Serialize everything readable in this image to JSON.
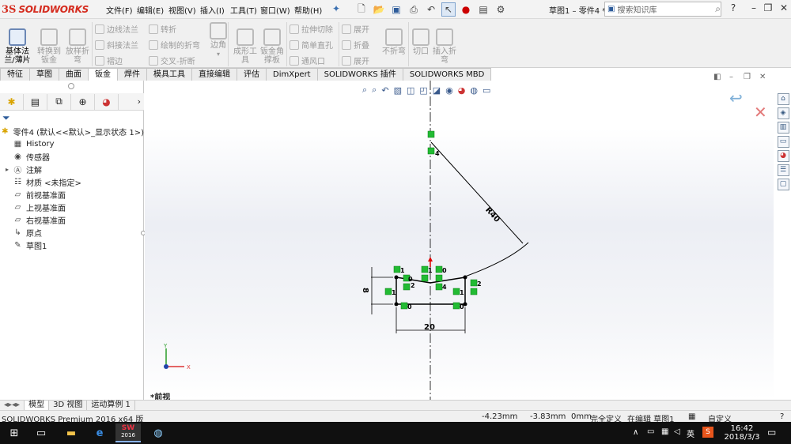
{
  "app": {
    "logo_ds": "3S",
    "logo_name": "SOLIDWORKS",
    "doc_title": "草图1 – 零件4 *",
    "search_placeholder": "搜索知识库"
  },
  "menu": [
    "文件(F)",
    "编辑(E)",
    "视图(V)",
    "插入(I)",
    "工具(T)",
    "窗口(W)",
    "帮助(H)"
  ],
  "ribbon": {
    "base_flange": "基体法\n兰/薄片",
    "convert_sheet": "转换到\n钣金",
    "lofted_bend": "放样折\n弯",
    "edge_flange": "边线法兰",
    "miter_flange": "斜接法兰",
    "hem": "褶边",
    "jog": "转折",
    "sketched_bend": "绘制的折弯",
    "cross_break": "交叉-折断",
    "corners": "边角",
    "forming_tool": "成形工\n具",
    "gusset": "钣金角\n撑板",
    "extruded_cut": "拉伸切除",
    "simple_hole": "简单直孔",
    "vent": "通风口",
    "unfold": "展开",
    "fold": "折叠",
    "flatten": "展开",
    "no_bends": "不折弯",
    "rip": "切口",
    "insert_bends": "插入折\n弯"
  },
  "tabs": [
    "特征",
    "草图",
    "曲面",
    "钣金",
    "焊件",
    "模具工具",
    "直接编辑",
    "评估",
    "DimXpert",
    "SOLIDWORKS 插件",
    "SOLIDWORKS MBD"
  ],
  "active_tab_index": 3,
  "tree": {
    "root": "零件4 (默认<<默认>_显示状态 1>)",
    "items": [
      "History",
      "传感器",
      "注解",
      "材质 <未指定>",
      "前视基准面",
      "上视基准面",
      "右视基准面",
      "原点",
      "草图1"
    ]
  },
  "graphics": {
    "view_label": "*前视",
    "dim_radius": "R40",
    "dim_width": "20",
    "dim_height": "8",
    "rel_1": "1",
    "rel_2": "2",
    "rel_4": "4",
    "rel_0": "0",
    "axis_x": "X",
    "axis_y": "Y"
  },
  "bottom_tabs": [
    "模型",
    "3D 视图",
    "运动算例 1"
  ],
  "status": {
    "edition": "SOLIDWORKS Premium 2016 x64 版",
    "x": "-4.23mm",
    "y": "-3.83mm",
    "z": "0mm",
    "state": "完全定义",
    "editing": "在编辑 草图1",
    "units": "自定义"
  },
  "taskbar": {
    "time": "16:42",
    "date": "2018/3/3",
    "ime": "英",
    "sw_label": "2016"
  },
  "colors": {
    "brand_red": "#d52b1e",
    "relation_green": "#22bb33",
    "sketch_black": "#000000"
  }
}
